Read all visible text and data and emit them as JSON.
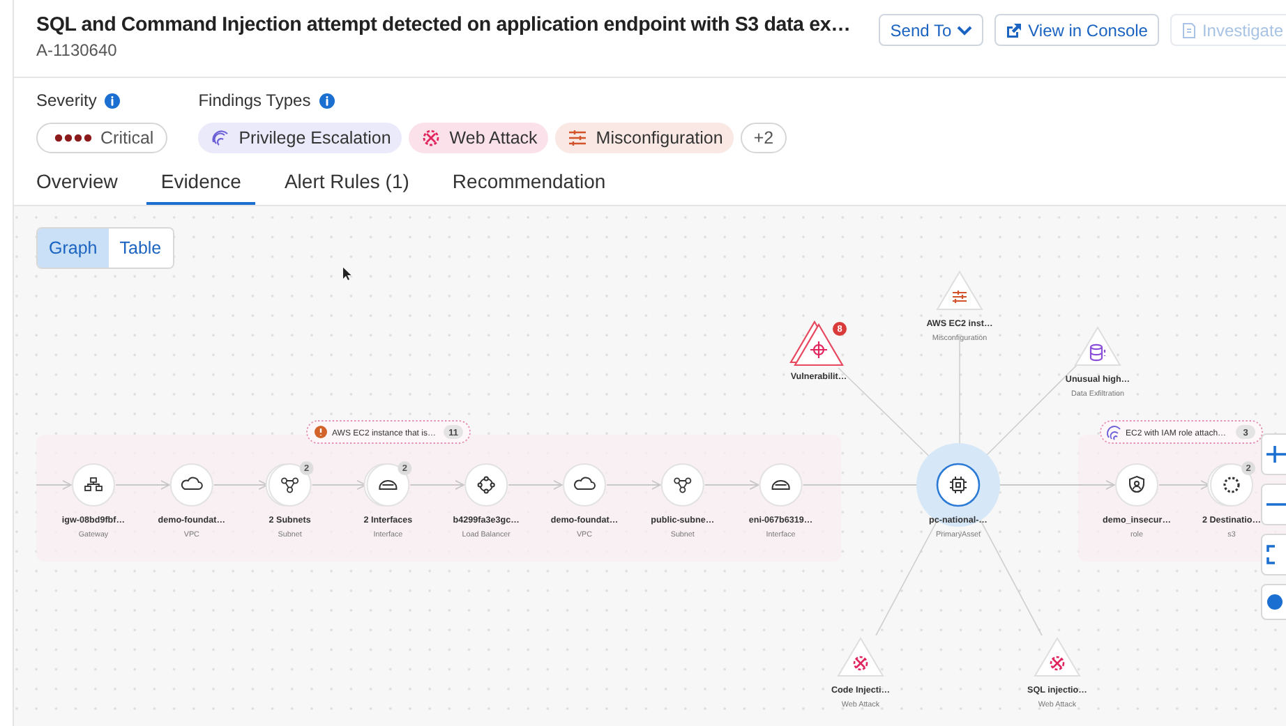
{
  "alert": {
    "title": "SQL and Command Injection attempt detected on application endpoint with S3 data ex…",
    "id": "A-1130640"
  },
  "actions": [
    {
      "label": "Send To",
      "kind": "dropdown",
      "disabled": false
    },
    {
      "label": "View in Console",
      "kind": "external",
      "disabled": false
    },
    {
      "label": "Investigate",
      "kind": "investigate",
      "disabled": true
    }
  ],
  "severity": {
    "label": "Severity",
    "value": "Critical",
    "kind": "critical"
  },
  "findings": {
    "label": "Findings Types",
    "more": "+2",
    "types": [
      {
        "label": "Privilege Escalation",
        "kind": "privilege",
        "color": "#6b5fd6"
      },
      {
        "label": "Web Attack",
        "kind": "web",
        "color": "#e0245e"
      },
      {
        "label": "Misconfiguration",
        "kind": "misconfig",
        "color": "#d2532a"
      }
    ]
  },
  "tabs": [
    {
      "label": "Overview",
      "selected": false
    },
    {
      "label": "Evidence",
      "selected": true
    },
    {
      "label": "Alert Rules (1)",
      "selected": false
    },
    {
      "label": "Recommendation",
      "selected": false
    }
  ],
  "view_toggle": [
    {
      "label": "Graph",
      "selected": true
    },
    {
      "label": "Table",
      "selected": false
    }
  ],
  "graph": {
    "groups": [
      {
        "label": "AWS EC2 instance that is…",
        "count": "11",
        "kind": "warning"
      },
      {
        "label": "EC2 with IAM role attach…",
        "count": "3",
        "kind": "privilege"
      }
    ],
    "path_nodes": [
      {
        "name": "igw-08bd9fbf…",
        "type": "Gateway",
        "kind": "gateway"
      },
      {
        "name": "demo-foundat…",
        "type": "VPC",
        "kind": "vpc"
      },
      {
        "name": "2 Subnets",
        "type": "Subnet",
        "kind": "subnet",
        "count": "2"
      },
      {
        "name": "2 Interfaces",
        "type": "Interface",
        "kind": "interface",
        "count": "2"
      },
      {
        "name": "b4299fa3e3gc…",
        "type": "Load Balancer",
        "kind": "balancer"
      },
      {
        "name": "demo-foundat…",
        "type": "VPC",
        "kind": "vpc"
      },
      {
        "name": "public-subne…",
        "type": "Subnet",
        "kind": "subnet"
      },
      {
        "name": "eni-067b6319…",
        "type": "Interface",
        "kind": "interface"
      }
    ],
    "primary": {
      "name": "pc-national-…",
      "type": "PrimaryAsset"
    },
    "downstream": [
      {
        "name": "demo_insecur…",
        "type": "role",
        "kind": "role"
      },
      {
        "name": "2 Destinatio…",
        "type": "s3",
        "kind": "s3",
        "count": "2"
      }
    ],
    "finding_nodes": [
      {
        "name": "Vulnerabilit…",
        "kind": "vulnerability",
        "count": "8"
      },
      {
        "name": "AWS EC2 inst…",
        "type": "Misconfiguration",
        "kind": "misconfig"
      },
      {
        "name": "Unusual high…",
        "type": "Data Exfiltration",
        "kind": "exfiltration"
      },
      {
        "name": "Code Injecti…",
        "type": "Web Attack",
        "kind": "web"
      },
      {
        "name": "SQL injectio…",
        "type": "Web Attack",
        "kind": "web"
      }
    ]
  }
}
